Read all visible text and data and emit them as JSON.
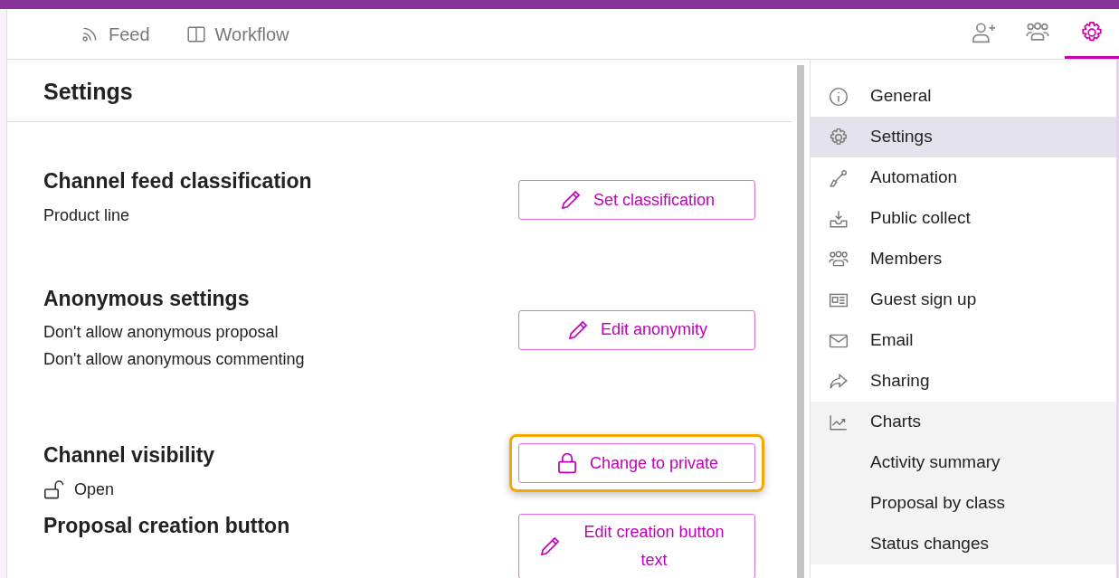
{
  "header_tabs": [
    {
      "kind": "rss",
      "label": "Feed",
      "selected": false
    },
    {
      "kind": "columns",
      "label": "Workflow",
      "selected": false
    }
  ],
  "header_icons": [
    {
      "kind": "person-add",
      "selected": false
    },
    {
      "kind": "people",
      "selected": false
    },
    {
      "kind": "gear",
      "selected": true
    }
  ],
  "page_title": "Settings",
  "sections": [
    {
      "title": "Channel feed classification",
      "lines": [
        {
          "text": "Product line"
        }
      ],
      "button": {
        "kind": "pencil",
        "label": "Set classification",
        "highlighted": false
      }
    },
    {
      "title": "Anonymous settings",
      "lines": [
        {
          "text": "Don't allow anonymous proposal"
        },
        {
          "text": "Don't allow anonymous commenting"
        }
      ],
      "button": {
        "kind": "pencil",
        "label": "Edit anonymity",
        "highlighted": false
      }
    },
    {
      "title": "Channel visibility",
      "lines": [
        {
          "text": "Open",
          "kind": "unlock"
        }
      ],
      "button": {
        "kind": "lock",
        "label": "Change to private",
        "highlighted": true
      }
    },
    {
      "title": "Proposal creation button",
      "button": {
        "kind": "pencil",
        "label": "Edit creation button text",
        "highlighted": false
      }
    }
  ],
  "sidebar": {
    "items": [
      {
        "kind": "info",
        "label": "General",
        "selected": false
      },
      {
        "kind": "gear",
        "label": "Settings",
        "selected": true
      },
      {
        "kind": "shovel",
        "label": "Automation",
        "selected": false
      },
      {
        "kind": "inbox",
        "label": "Public collect",
        "selected": false
      },
      {
        "kind": "people",
        "label": "Members",
        "selected": false
      },
      {
        "kind": "card",
        "label": "Guest sign up",
        "selected": false
      },
      {
        "kind": "mail",
        "label": "Email",
        "selected": false
      },
      {
        "kind": "share",
        "label": "Sharing",
        "selected": false
      },
      {
        "kind": "chart",
        "label": "Charts",
        "selected": false,
        "expanded": true,
        "children": [
          {
            "label": "Activity summary",
            "selected": false
          },
          {
            "label": "Proposal by class",
            "selected": false
          },
          {
            "label": "Status changes",
            "selected": false
          }
        ]
      }
    ]
  }
}
